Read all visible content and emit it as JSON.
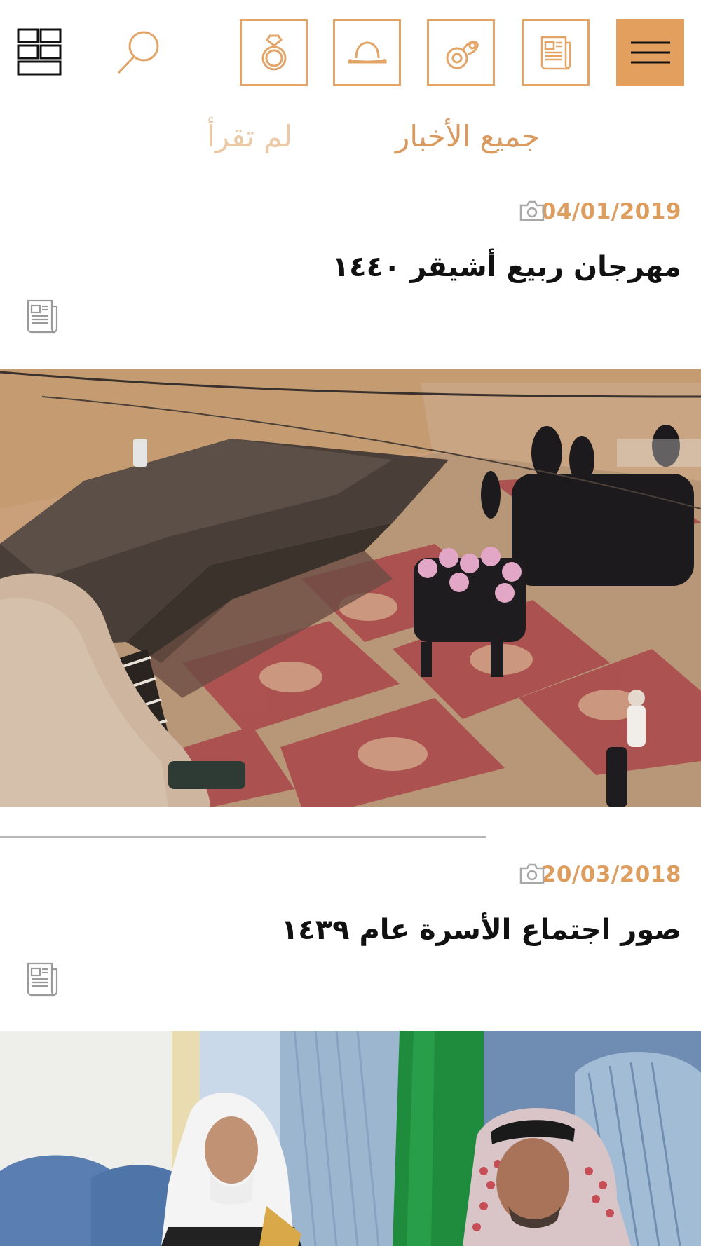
{
  "topbar": {
    "icons": [
      "menu-icon",
      "newspaper-icon",
      "pacifier-icon",
      "tent-icon",
      "ring-icon",
      "search-icon",
      "grid-icon"
    ],
    "accent": "#e39f5e"
  },
  "tabs": [
    {
      "label": "جميع الأخبار",
      "active": true
    },
    {
      "label": "لم تقرأ",
      "active": false
    }
  ],
  "news": [
    {
      "date": "04/01/2019",
      "title": "مهرجان ربيع أشيقر ١٤٤٠",
      "type_icon": "newspaper-icon",
      "media_icon": "camera-icon",
      "image": "festival-tent-gathering-photo"
    },
    {
      "date": "20/03/2018",
      "title": "صور اجتماع الأسرة عام ١٤٣٩",
      "type_icon": "newspaper-icon",
      "media_icon": "camera-icon",
      "image": "family-meeting-photo"
    }
  ]
}
